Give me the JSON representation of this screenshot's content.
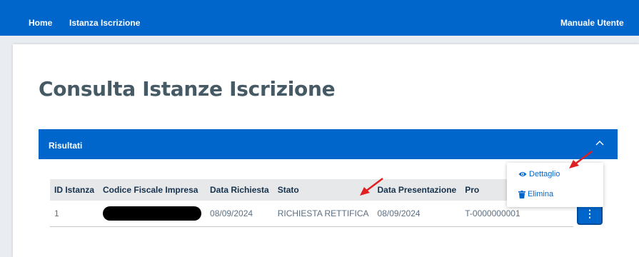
{
  "nav": {
    "home": "Home",
    "istanza": "Istanza Iscrizione",
    "manuale": "Manuale Utente"
  },
  "page": {
    "title": "Consulta Istanze Iscrizione"
  },
  "results": {
    "label": "Risultati"
  },
  "table": {
    "headers": [
      "ID Istanza",
      "Codice Fiscale Impresa",
      "Data Richiesta",
      "Stato",
      "Data Presentazione",
      "Pro"
    ],
    "rows": [
      {
        "id": "1",
        "cf": "",
        "data_richiesta": "08/09/2024",
        "stato": "RICHIESTA RETTIFICA",
        "data_presentazione": "08/09/2024",
        "protocollo": "T-0000000001"
      }
    ]
  },
  "menu": {
    "dettaglio": "Dettaglio",
    "elimina": "Elimina"
  },
  "actions": {
    "kebab": "⋮"
  },
  "colors": {
    "primary": "#0066cc",
    "title": "#455a64",
    "arrow": "#e02020"
  }
}
